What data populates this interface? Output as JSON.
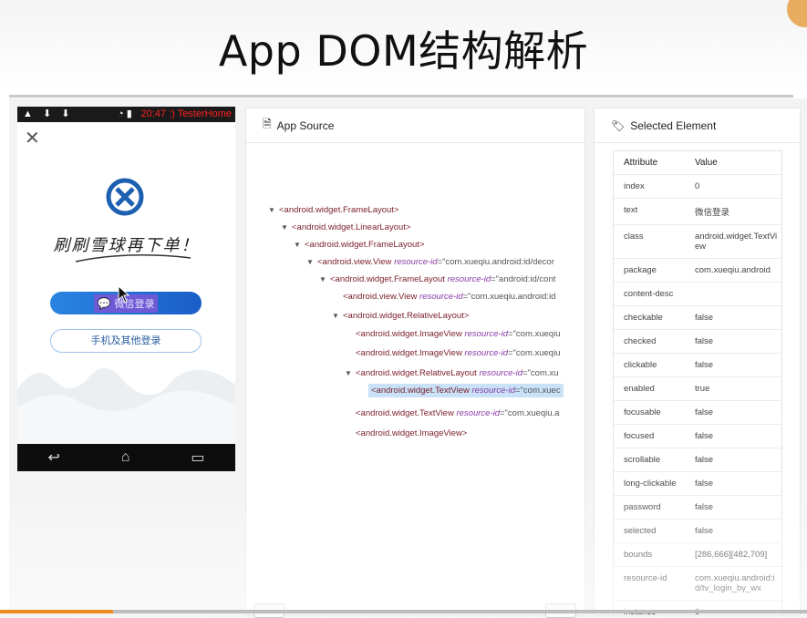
{
  "slide_title": "App DOM结构解析",
  "phone": {
    "status_left": "▲ ⬇ ⬇",
    "status_right": "20:47 :) TesterHome",
    "close_icon": "✕",
    "slogan": "刷刷雪球再下单！",
    "wechat_button": "微信登录",
    "phone_login_button": "手机及其他登录",
    "nav_back": "↩",
    "nav_home": "⌂",
    "nav_recents": "▭"
  },
  "app_source": {
    "title": "App Source",
    "nodes": [
      {
        "caret": "▼",
        "tag": "<android.widget.FrameLayout>",
        "attr": "",
        "val": ""
      },
      {
        "caret": "▼",
        "tag": "<android.widget.LinearLayout>",
        "attr": "",
        "val": ""
      },
      {
        "caret": "▼",
        "tag": "<android.widget.FrameLayout>",
        "attr": "",
        "val": ""
      },
      {
        "caret": "▼",
        "tag": "<android.view.View ",
        "attr": "resource-id",
        "val": "=\"com.xueqiu.android:id/decor"
      },
      {
        "caret": "▼",
        "tag": "<android.widget.FrameLayout ",
        "attr": "resource-id",
        "val": "=\"android:id/cont"
      },
      {
        "caret": "",
        "tag": "<android.view.View ",
        "attr": "resource-id",
        "val": "=\"com.xueqiu.android:id"
      },
      {
        "caret": "▼",
        "tag": "<android.widget.RelativeLayout>",
        "attr": "",
        "val": ""
      },
      {
        "caret": "",
        "tag": "<android.widget.ImageView ",
        "attr": "resource-id",
        "val": "=\"com.xueqiu"
      },
      {
        "caret": "",
        "tag": "<android.widget.ImageView ",
        "attr": "resource-id",
        "val": "=\"com.xueqiu"
      },
      {
        "caret": "▼",
        "tag": "<android.widget.RelativeLayout ",
        "attr": "resource-id",
        "val": "=\"com.xu"
      },
      {
        "caret": "",
        "tag": "<android.widget.TextView ",
        "attr": "resource-id",
        "val": "=\"com.xuec"
      },
      {
        "caret": "",
        "tag": "<android.widget.TextView ",
        "attr": "resource-id",
        "val": "=\"com.xueqiu.a"
      },
      {
        "caret": "",
        "tag": "<android.widget.ImageView>",
        "attr": "",
        "val": ""
      }
    ]
  },
  "selected_element": {
    "title": "Selected Element",
    "col_attribute": "Attribute",
    "col_value": "Value",
    "rows": [
      {
        "k": "index",
        "v": "0"
      },
      {
        "k": "text",
        "v": "微信登录"
      },
      {
        "k": "class",
        "v": "android.widget.TextView"
      },
      {
        "k": "package",
        "v": "com.xueqiu.android"
      },
      {
        "k": "content-desc",
        "v": ""
      },
      {
        "k": "checkable",
        "v": "false"
      },
      {
        "k": "checked",
        "v": "false"
      },
      {
        "k": "clickable",
        "v": "false"
      },
      {
        "k": "enabled",
        "v": "true"
      },
      {
        "k": "focusable",
        "v": "false"
      },
      {
        "k": "focused",
        "v": "false"
      },
      {
        "k": "scrollable",
        "v": "false"
      },
      {
        "k": "long-clickable",
        "v": "false"
      },
      {
        "k": "password",
        "v": "false"
      },
      {
        "k": "selected",
        "v": "false"
      },
      {
        "k": "bounds",
        "v": "[286,666][482,709]"
      },
      {
        "k": "resource-id",
        "v": "com.xueqiu.android:id/tv_login_by_wx"
      },
      {
        "k": "instance",
        "v": "0"
      }
    ]
  },
  "video_progress": 0.14
}
